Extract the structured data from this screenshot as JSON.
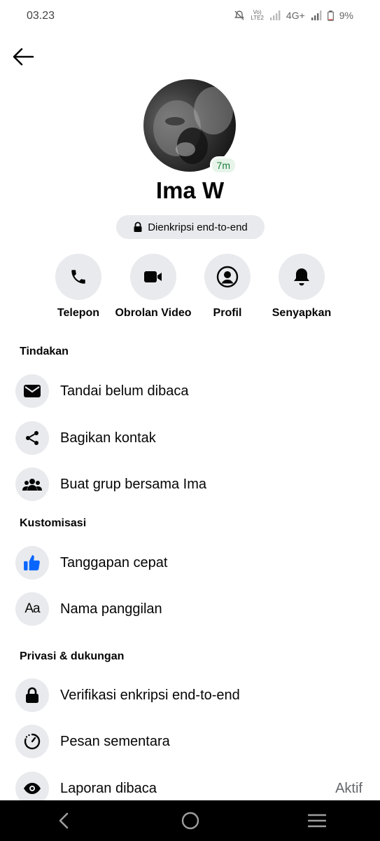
{
  "status_bar": {
    "time": "03.23",
    "network": "4G+",
    "battery": "9%"
  },
  "profile": {
    "name": "Ima W",
    "active_badge": "7m",
    "encryption_label": "Dienkripsi end-to-end"
  },
  "actions": [
    {
      "label": "Telepon",
      "icon": "phone-icon"
    },
    {
      "label": "Obrolan Video",
      "icon": "video-camera-icon"
    },
    {
      "label": "Profil",
      "icon": "profile-icon"
    },
    {
      "label": "Senyapkan",
      "icon": "bell-icon"
    }
  ],
  "sections": {
    "actions_title": "Tindakan",
    "customization_title": "Kustomisasi",
    "privacy_title": "Privasi & dukungan"
  },
  "menu": {
    "mark_unread": "Tandai belum dibaca",
    "share_contact": "Bagikan kontak",
    "create_group": "Buat grup bersama Ima",
    "quick_reaction": "Tanggapan cepat",
    "nicknames": "Nama panggilan",
    "verify_encryption": "Verifikasi enkripsi end-to-end",
    "disappearing_messages": "Pesan sementara",
    "read_receipts": "Laporan dibaca",
    "read_receipts_value": "Aktif"
  },
  "colors": {
    "accent": "#0866ff",
    "icon_bg": "#e9eaed",
    "active_green": "#1a7f37",
    "secondary_text": "#65676b"
  }
}
